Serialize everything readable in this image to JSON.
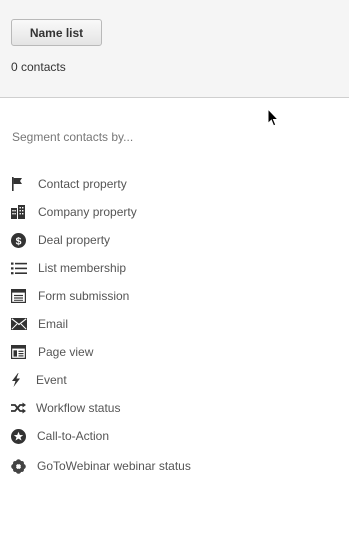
{
  "header": {
    "name_list_button": "Name list",
    "contact_count": "0 contacts"
  },
  "segment": {
    "heading": "Segment contacts by...",
    "items": [
      {
        "label": "Contact property",
        "icon": "flag-icon"
      },
      {
        "label": "Company property",
        "icon": "building-icon"
      },
      {
        "label": "Deal property",
        "icon": "dollar-coin-icon"
      },
      {
        "label": "List membership",
        "icon": "list-icon"
      },
      {
        "label": "Form submission",
        "icon": "form-icon"
      },
      {
        "label": "Email",
        "icon": "envelope-icon"
      },
      {
        "label": "Page view",
        "icon": "page-layout-icon"
      },
      {
        "label": "Event",
        "icon": "lightning-icon"
      },
      {
        "label": "Workflow status",
        "icon": "shuffle-icon"
      },
      {
        "label": "Call-to-Action",
        "icon": "star-circle-icon"
      },
      {
        "label": "GoToWebinar webinar status",
        "icon": "gotowebinar-flower-icon"
      }
    ]
  }
}
